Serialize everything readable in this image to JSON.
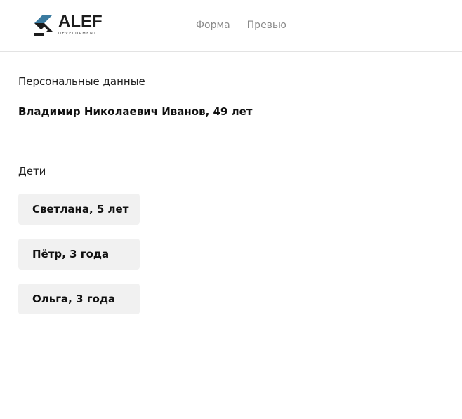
{
  "header": {
    "logo": {
      "name": "ALEF",
      "tagline": "DEVELOPMENT",
      "colors": {
        "blue": "#3a7ba0",
        "dark": "#1c1c1c"
      }
    },
    "nav": [
      {
        "label": "Форма"
      },
      {
        "label": "Превью"
      }
    ]
  },
  "personal": {
    "title": "Персональные данные",
    "summary": "Владимир Николаевич Иванов, 49 лет"
  },
  "children": {
    "title": "Дети",
    "items": [
      {
        "label": "Светлана, 5 лет"
      },
      {
        "label": "Пётр, 3 года"
      },
      {
        "label": "Ольга, 3 года"
      }
    ]
  }
}
